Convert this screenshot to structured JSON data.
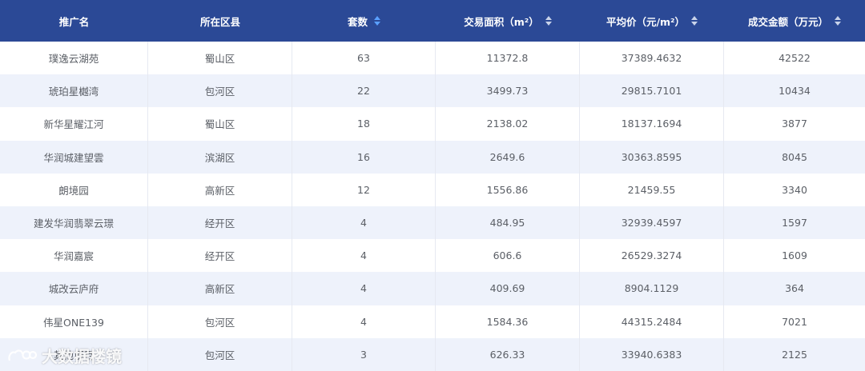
{
  "columns": [
    {
      "label": "推广名",
      "sortable": false,
      "sort_active": false
    },
    {
      "label": "所在区县",
      "sortable": false,
      "sort_active": false
    },
    {
      "label": "套数",
      "sortable": true,
      "sort_active": true
    },
    {
      "label": "交易面积（m²）",
      "sortable": true,
      "sort_active": false
    },
    {
      "label": "平均价（元/m²）",
      "sortable": true,
      "sort_active": false
    },
    {
      "label": "成交金额（万元）",
      "sortable": true,
      "sort_active": false
    }
  ],
  "rows": [
    [
      "璞逸云湖苑",
      "蜀山区",
      "63",
      "11372.8",
      "37389.4632",
      "42522"
    ],
    [
      "琥珀星樾湾",
      "包河区",
      "22",
      "3499.73",
      "29815.7101",
      "10434"
    ],
    [
      "新华星耀江河",
      "蜀山区",
      "18",
      "2138.02",
      "18137.1694",
      "3877"
    ],
    [
      "华润城建望雲",
      "滨湖区",
      "16",
      "2649.6",
      "30363.8595",
      "8045"
    ],
    [
      "朗境园",
      "高新区",
      "12",
      "1556.86",
      "21459.55",
      "3340"
    ],
    [
      "建发华润翡翠云璟",
      "经开区",
      "4",
      "484.95",
      "32939.4597",
      "1597"
    ],
    [
      "华润嘉宸",
      "经开区",
      "4",
      "606.6",
      "26529.3274",
      "1609"
    ],
    [
      "城改云庐府",
      "高新区",
      "4",
      "409.69",
      "8904.1129",
      "364"
    ],
    [
      "伟星ONE139",
      "包河区",
      "4",
      "1584.36",
      "44315.2484",
      "7021"
    ],
    [
      "其他项目",
      "包河区",
      "3",
      "626.33",
      "33940.6383",
      "2125"
    ]
  ],
  "watermark": {
    "text": "大数据楼镜",
    "icon": "logo-icon"
  },
  "colors": {
    "header_bg": "#2b4996",
    "stripe": "#eef2fb",
    "sort_active": "#5aa0ff"
  }
}
